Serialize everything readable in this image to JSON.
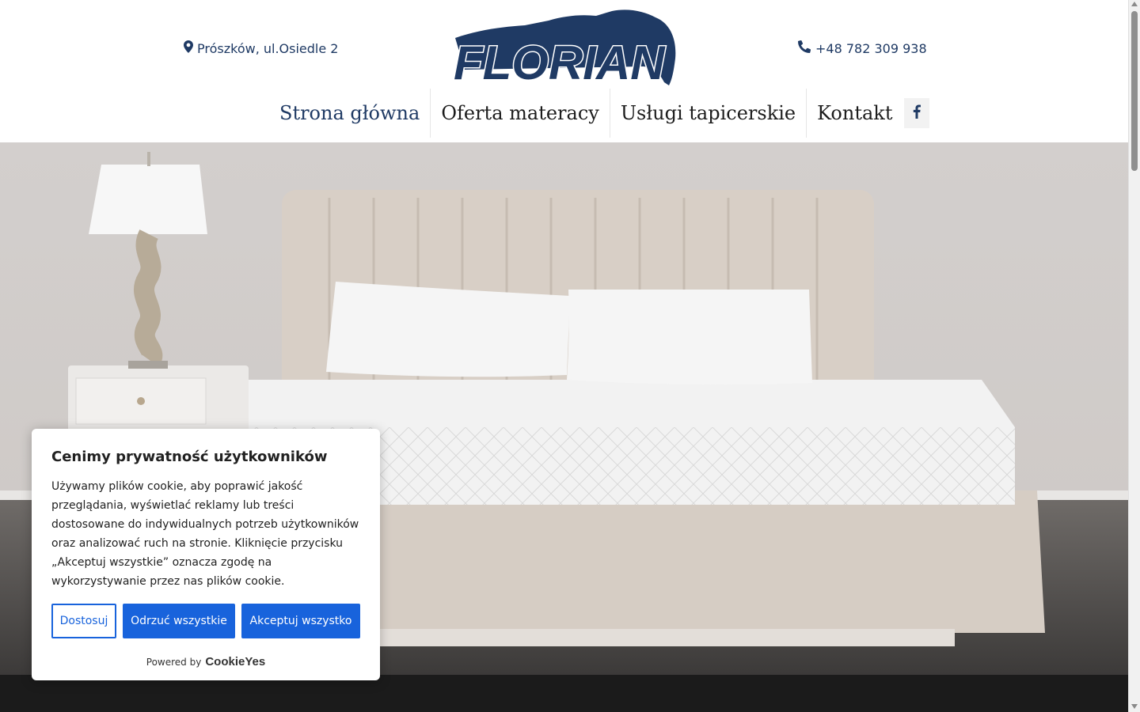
{
  "header": {
    "address": "Prószków, ul.Osiedle 2",
    "phone": "+48 782 309 938",
    "logo_text": "FLORIAN",
    "brand_color": "#1f3a64"
  },
  "nav": {
    "items": [
      {
        "label": "Strona główna",
        "active": true
      },
      {
        "label": "Oferta materacy",
        "active": false
      },
      {
        "label": "Usługi tapicerskie",
        "active": false
      },
      {
        "label": "Kontakt",
        "active": false
      }
    ],
    "social_icon": "facebook-icon"
  },
  "cookie_banner": {
    "title": "Cenimy prywatność użytkowników",
    "body": "Używamy plików cookie, aby poprawić jakość przeglądania, wyświetlać reklamy lub treści dostosowane do indywidualnych potrzeb użytkowników oraz analizować ruch na stronie. Kliknięcie przycisku „Akceptuj wszystkie” oznacza zgodę na wykorzystywanie przez nas plików cookie.",
    "buttons": {
      "customize": "Dostosuj",
      "reject": "Odrzuć wszystkie",
      "accept": "Akceptuj wszystko"
    },
    "powered_by": "Powered by",
    "brand": "CookieYes",
    "accent_color": "#1863dc"
  }
}
